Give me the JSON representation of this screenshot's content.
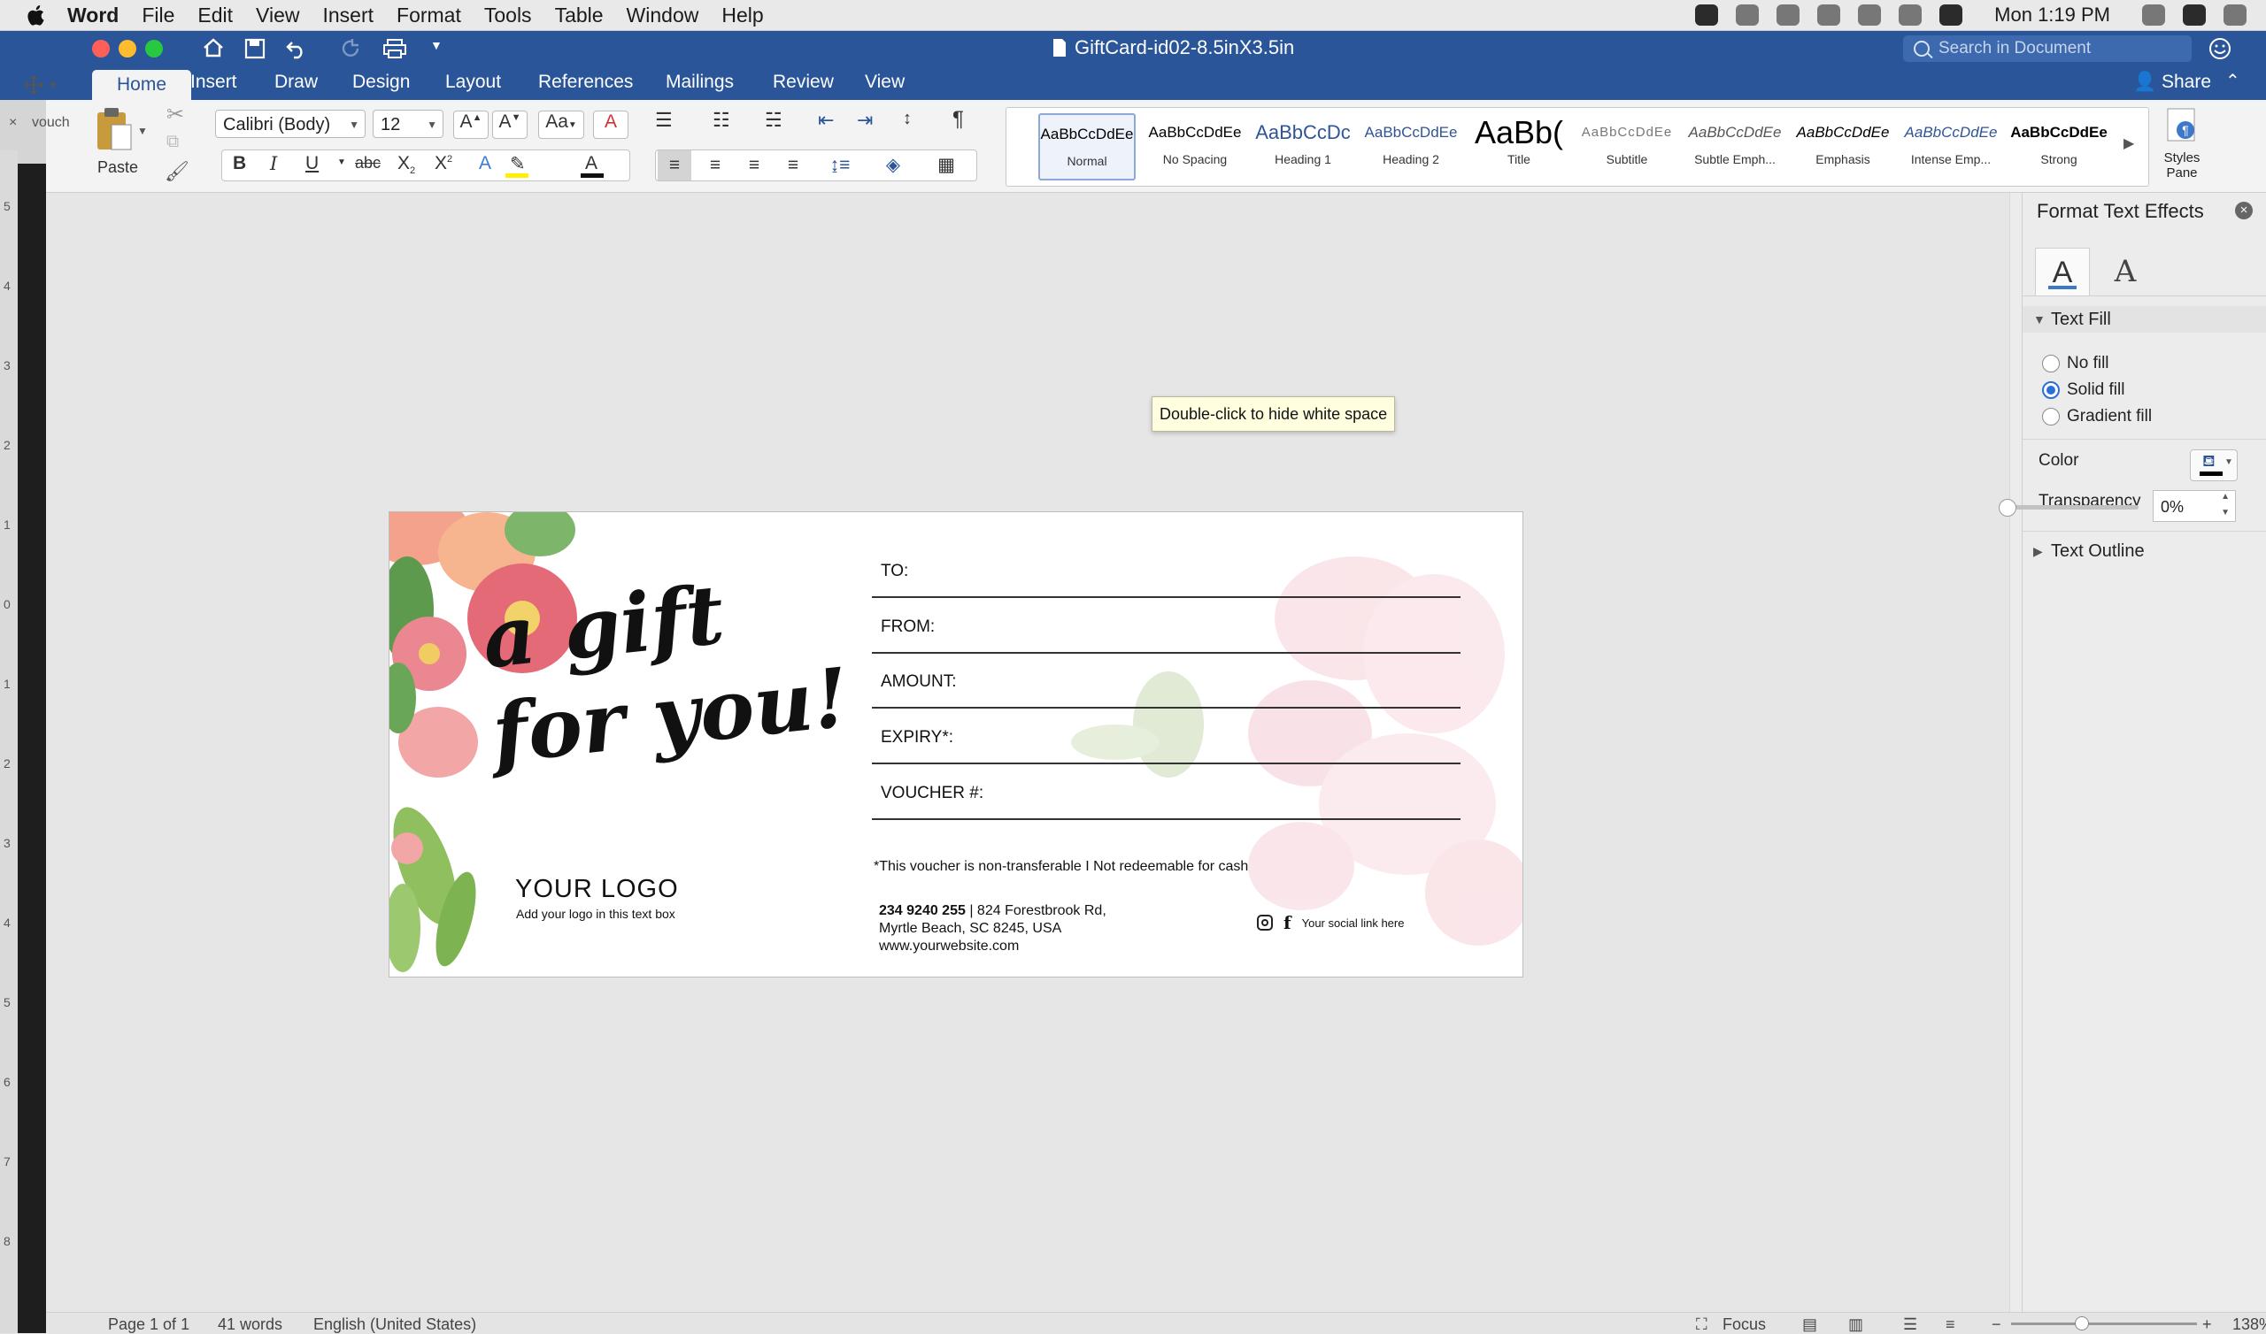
{
  "menubar": {
    "app": "Word",
    "items": [
      "File",
      "Edit",
      "View",
      "Insert",
      "Format",
      "Tools",
      "Table",
      "Window",
      "Help"
    ],
    "clock": "Mon 1:19 PM"
  },
  "window": {
    "title": "GiftCard-id02-8.5inX3.5in",
    "search_placeholder": "Search in Document",
    "share_label": "Share"
  },
  "tabs": [
    "Home",
    "Insert",
    "Draw",
    "Design",
    "Layout",
    "References",
    "Mailings",
    "Review",
    "View"
  ],
  "ribbon": {
    "paste_label": "Paste",
    "font_name": "Calibri (Body)",
    "font_size": "12",
    "styles": [
      {
        "sample": "AaBbCcDdEe",
        "label": "Normal"
      },
      {
        "sample": "AaBbCcDdEe",
        "label": "No Spacing"
      },
      {
        "sample": "AaBbCcDc",
        "label": "Heading 1"
      },
      {
        "sample": "AaBbCcDdEe",
        "label": "Heading 2"
      },
      {
        "sample": "AaBb(",
        "label": "Title"
      },
      {
        "sample": "AaBbCcDdEe",
        "label": "Subtitle"
      },
      {
        "sample": "AaBbCcDdEe",
        "label": "Subtle Emph..."
      },
      {
        "sample": "AaBbCcDdEe",
        "label": "Emphasis"
      },
      {
        "sample": "AaBbCcDdEe",
        "label": "Intense Emp..."
      },
      {
        "sample": "AaBbCcDdEe",
        "label": "Strong"
      }
    ],
    "styles_pane_label": "Styles Pane"
  },
  "sidebar": {
    "tab_label": "vouch"
  },
  "ruler": {
    "numbers": [
      "5",
      "4",
      "3",
      "2",
      "1",
      "0",
      "1",
      "2",
      "3",
      "4",
      "5",
      "6",
      "7",
      "8"
    ]
  },
  "tooltip": "Double-click to hide white space",
  "card": {
    "title": "a gift\nfor you!",
    "fields": [
      "TO:",
      "FROM:",
      "AMOUNT:",
      "EXPIRY*:",
      "VOUCHER #:"
    ],
    "disclaimer": "*This voucher is non-transferable I Not redeemable for cash",
    "logo_title": "YOUR LOGO",
    "logo_sub": "Add your logo in this text box",
    "phone": "234 9240 255",
    "address_line1": " | 824 Forestbrook Rd,",
    "address_line2": "Myrtle Beach, SC 8245, USA",
    "website": "www.yourwebsite.com",
    "social": "Your social link here"
  },
  "pane": {
    "title": "Format Text Effects",
    "text_fill_header": "Text Fill",
    "options": [
      "No fill",
      "Solid fill",
      "Gradient fill"
    ],
    "selected_option": "Solid fill",
    "color_label": "Color",
    "color_value": "#000000",
    "transparency_label": "Transparency",
    "transparency_value": "0%",
    "text_outline_header": "Text Outline"
  },
  "status": {
    "page": "Page 1 of 1",
    "words": "41 words",
    "language": "English (United States)",
    "focus": "Focus",
    "zoom": "138%"
  },
  "colors": {
    "ribbon_blue": "#2a5599",
    "accent": "#2a6fd6"
  }
}
